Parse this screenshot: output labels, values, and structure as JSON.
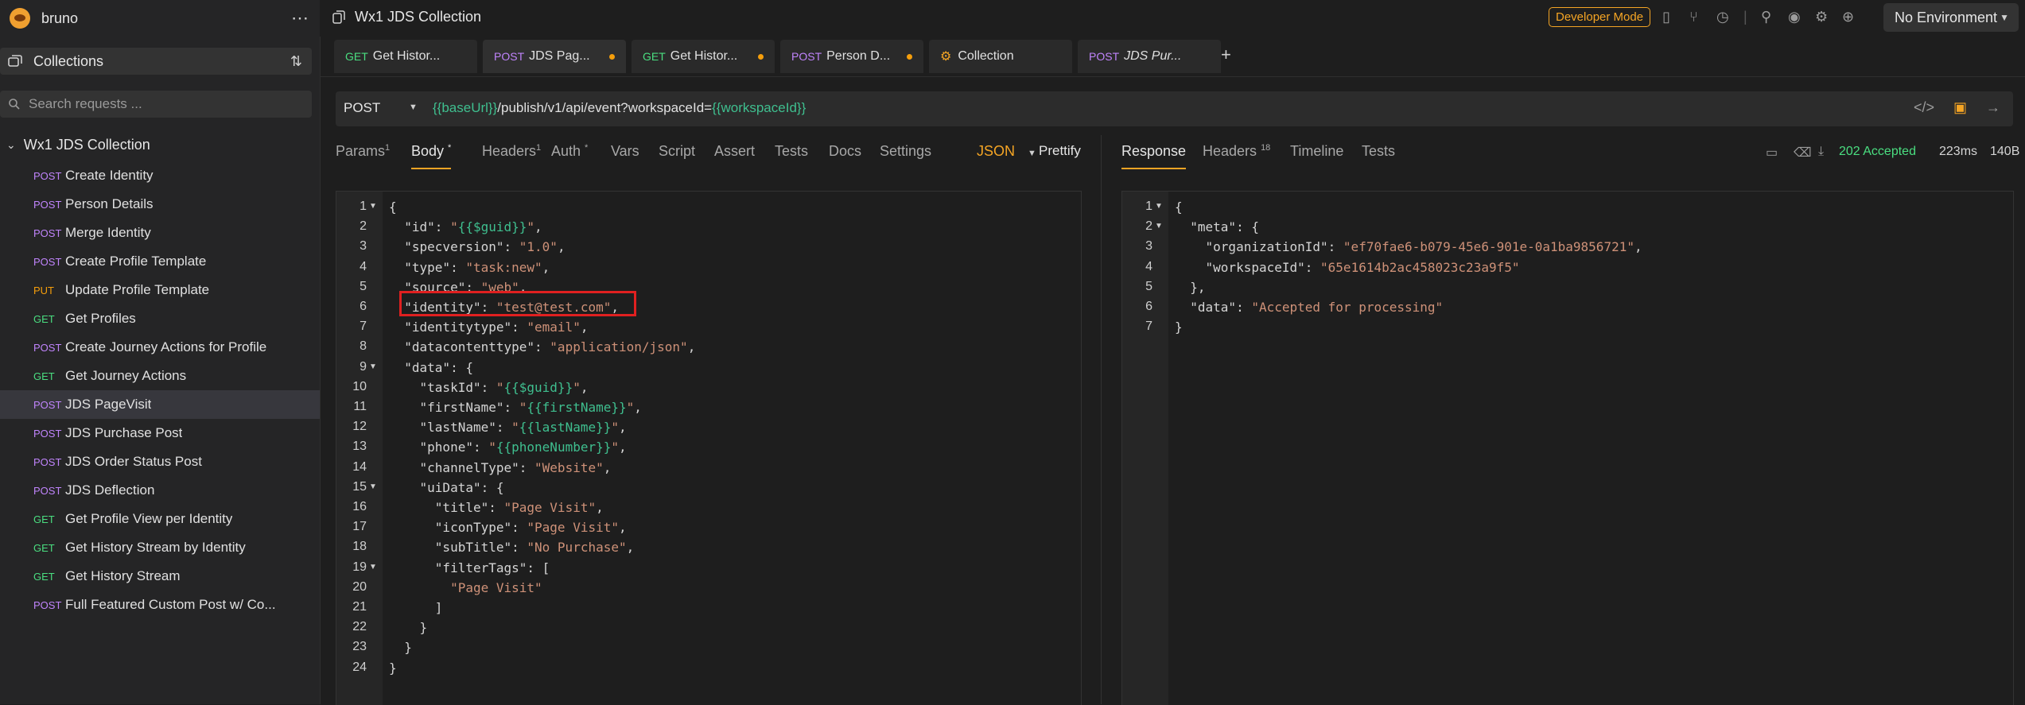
{
  "app": {
    "name": "bruno"
  },
  "sidebar": {
    "collections_label": "Collections",
    "search_placeholder": "Search requests ...",
    "collection_name": "Wx1 JDS Collection",
    "requests": [
      {
        "method": "POST",
        "name": "Create Identity"
      },
      {
        "method": "POST",
        "name": "Person Details"
      },
      {
        "method": "POST",
        "name": "Merge Identity"
      },
      {
        "method": "POST",
        "name": "Create Profile Template"
      },
      {
        "method": "PUT",
        "name": "Update Profile Template"
      },
      {
        "method": "GET",
        "name": "Get Profiles"
      },
      {
        "method": "POST",
        "name": "Create Journey Actions for Profile"
      },
      {
        "method": "GET",
        "name": "Get Journey Actions"
      },
      {
        "method": "POST",
        "name": "JDS PageVisit",
        "active": true
      },
      {
        "method": "POST",
        "name": "JDS Purchase Post"
      },
      {
        "method": "POST",
        "name": "JDS Order Status Post"
      },
      {
        "method": "POST",
        "name": "JDS Deflection"
      },
      {
        "method": "GET",
        "name": "Get Profile View per Identity"
      },
      {
        "method": "GET",
        "name": "Get History Stream by Identity"
      },
      {
        "method": "GET",
        "name": "Get History Stream"
      },
      {
        "method": "POST",
        "name": "Full Featured Custom Post w/ Co..."
      }
    ]
  },
  "topbar": {
    "title": "Wx1 JDS Collection",
    "dev_mode": "Developer Mode",
    "environment": "No Environment"
  },
  "tabs": [
    {
      "method": "GET",
      "name": "Get Histor...",
      "dot": false
    },
    {
      "method": "POST",
      "name": "JDS Pag...",
      "dot": true,
      "active": true
    },
    {
      "method": "GET",
      "name": "Get Histor...",
      "dot": true
    },
    {
      "method": "POST",
      "name": "Person D...",
      "dot": true
    },
    {
      "method": "",
      "name": "Collection",
      "dot": false
    },
    {
      "method": "POST",
      "name": "JDS Pur...",
      "dot": false,
      "italic": true
    }
  ],
  "request": {
    "method": "POST",
    "url_parts": [
      {
        "text": "{{baseUrl}}",
        "var": true
      },
      {
        "text": "/publish/v1/api/event?workspaceId=",
        "var": false
      },
      {
        "text": "{{workspaceId}}",
        "var": true
      }
    ],
    "tabs": {
      "params": "Params",
      "params_count": "1",
      "body": "Body",
      "body_mark": "*",
      "headers": "Headers",
      "headers_count": "1",
      "auth": "Auth",
      "auth_mark": "*",
      "vars": "Vars",
      "script": "Script",
      "assert": "Assert",
      "tests": "Tests",
      "docs": "Docs",
      "settings": "Settings"
    },
    "body_mode": "JSON",
    "prettify": "Prettify",
    "body_lines": [
      [
        [
          "{",
          "k"
        ]
      ],
      [
        [
          "  \"id\": ",
          "k"
        ],
        [
          "\"",
          "s"
        ],
        [
          "{{$guid}}",
          "v"
        ],
        [
          "\"",
          "s"
        ],
        [
          ",",
          "k"
        ]
      ],
      [
        [
          "  \"specversion\": ",
          "k"
        ],
        [
          "\"1.0\"",
          "s"
        ],
        [
          ",",
          "k"
        ]
      ],
      [
        [
          "  \"type\": ",
          "k"
        ],
        [
          "\"task:new\"",
          "s"
        ],
        [
          ",",
          "k"
        ]
      ],
      [
        [
          "  \"source\": ",
          "k"
        ],
        [
          "\"web\"",
          "s"
        ],
        [
          ",",
          "k"
        ]
      ],
      [
        [
          "  \"identity\": ",
          "k"
        ],
        [
          "\"test@test.com\"",
          "s"
        ],
        [
          ",",
          "k"
        ]
      ],
      [
        [
          "  \"identitytype\": ",
          "k"
        ],
        [
          "\"email\"",
          "s"
        ],
        [
          ",",
          "k"
        ]
      ],
      [
        [
          "  \"datacontenttype\": ",
          "k"
        ],
        [
          "\"application/json\"",
          "s"
        ],
        [
          ",",
          "k"
        ]
      ],
      [
        [
          "  \"data\": {",
          "k"
        ]
      ],
      [
        [
          "    \"taskId\": ",
          "k"
        ],
        [
          "\"",
          "s"
        ],
        [
          "{{$guid}}",
          "v"
        ],
        [
          "\"",
          "s"
        ],
        [
          ",",
          "k"
        ]
      ],
      [
        [
          "    \"firstName\": ",
          "k"
        ],
        [
          "\"",
          "s"
        ],
        [
          "{{firstName}}",
          "v"
        ],
        [
          "\"",
          "s"
        ],
        [
          ",",
          "k"
        ]
      ],
      [
        [
          "    \"lastName\": ",
          "k"
        ],
        [
          "\"",
          "s"
        ],
        [
          "{{lastName}}",
          "v"
        ],
        [
          "\"",
          "s"
        ],
        [
          ",",
          "k"
        ]
      ],
      [
        [
          "    \"phone\": ",
          "k"
        ],
        [
          "\"",
          "s"
        ],
        [
          "{{phoneNumber}}",
          "v"
        ],
        [
          "\"",
          "s"
        ],
        [
          ",",
          "k"
        ]
      ],
      [
        [
          "    \"channelType\": ",
          "k"
        ],
        [
          "\"Website\"",
          "s"
        ],
        [
          ",",
          "k"
        ]
      ],
      [
        [
          "    \"uiData\": {",
          "k"
        ]
      ],
      [
        [
          "      \"title\": ",
          "k"
        ],
        [
          "\"Page Visit\"",
          "s"
        ],
        [
          ",",
          "k"
        ]
      ],
      [
        [
          "      \"iconType\": ",
          "k"
        ],
        [
          "\"Page Visit\"",
          "s"
        ],
        [
          ",",
          "k"
        ]
      ],
      [
        [
          "      \"subTitle\": ",
          "k"
        ],
        [
          "\"No Purchase\"",
          "s"
        ],
        [
          ",",
          "k"
        ]
      ],
      [
        [
          "      \"filterTags\": [",
          "k"
        ]
      ],
      [
        [
          "        ",
          "k"
        ],
        [
          "\"Page Visit\"",
          "s"
        ]
      ],
      [
        [
          "      ]",
          "k"
        ]
      ],
      [
        [
          "    }",
          "k"
        ]
      ],
      [
        [
          "  }",
          "k"
        ]
      ],
      [
        [
          "}",
          "k"
        ]
      ]
    ],
    "body_folds": [
      1,
      9,
      15,
      19
    ]
  },
  "response": {
    "tabs": {
      "response": "Response",
      "headers": "Headers",
      "headers_count": "18",
      "timeline": "Timeline",
      "tests": "Tests"
    },
    "status": "202 Accepted",
    "time": "223ms",
    "size": "140B",
    "lines": [
      [
        [
          "{",
          "k"
        ]
      ],
      [
        [
          "  \"meta\": {",
          "k"
        ]
      ],
      [
        [
          "    \"organizationId\": ",
          "k"
        ],
        [
          "\"ef70fae6-b079-45e6-901e-0a1ba9856721\"",
          "s"
        ],
        [
          ",",
          "k"
        ]
      ],
      [
        [
          "    \"workspaceId\": ",
          "k"
        ],
        [
          "\"65e1614b2ac458023c23a9f5\"",
          "s"
        ]
      ],
      [
        [
          "  },",
          "k"
        ]
      ],
      [
        [
          "  \"data\": ",
          "k"
        ],
        [
          "\"Accepted for processing\"",
          "s"
        ]
      ],
      [
        [
          "}",
          "k"
        ]
      ]
    ],
    "folds": [
      1,
      2
    ]
  },
  "colors": {
    "accent": "#f5a524",
    "post": "#c084fc",
    "get": "#4ade80",
    "put": "#f59e0b",
    "variable": "#3fbf8f",
    "string": "#ce9178",
    "highlight_box": "#e02020"
  }
}
